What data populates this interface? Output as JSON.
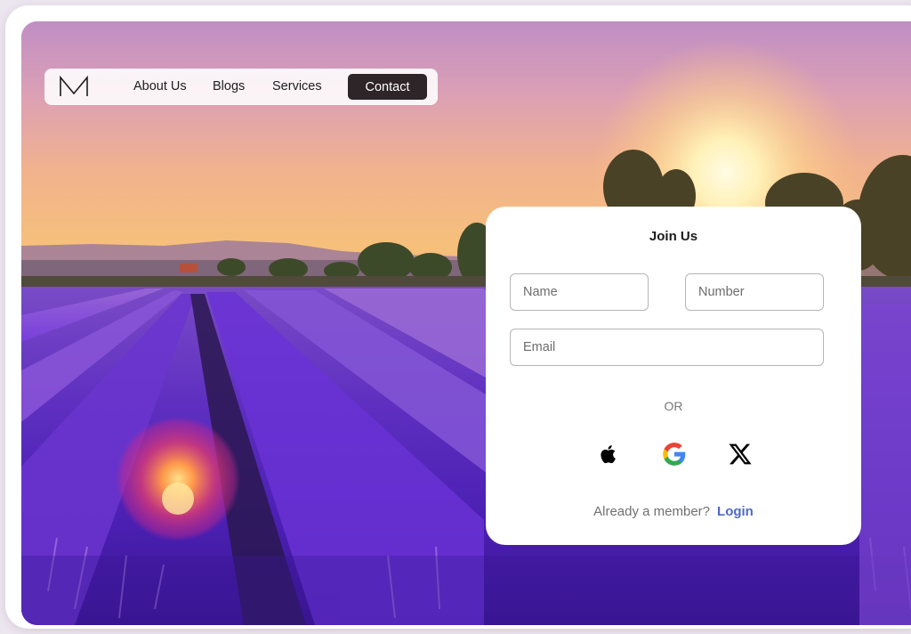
{
  "nav": {
    "logo_letter": "M",
    "links": [
      "About Us",
      "Blogs",
      "Services"
    ],
    "contact_label": "Contact"
  },
  "join": {
    "title": "Join Us",
    "name_placeholder": "Name",
    "number_placeholder": "Number",
    "email_placeholder": "Email",
    "or_label": "OR",
    "social_icons": [
      "apple-icon",
      "google-icon",
      "x-icon"
    ],
    "member_text": "Already a member?",
    "login_label": "Login"
  },
  "colors": {
    "contact_button": "#2e2528",
    "login_link": "#4f69c6",
    "card_background": "#ffffff"
  }
}
